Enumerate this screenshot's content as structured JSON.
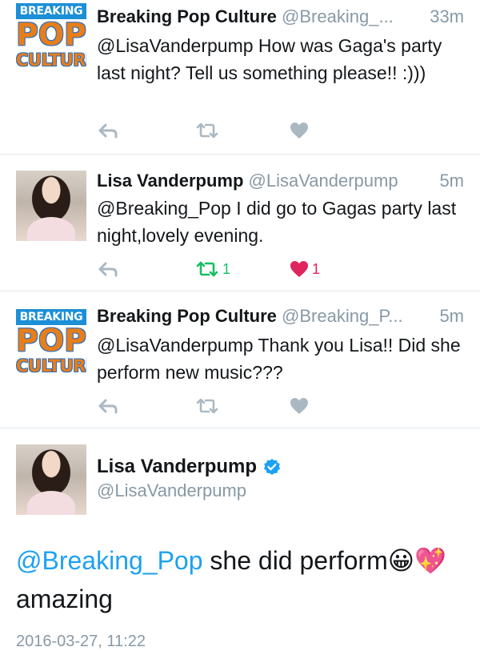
{
  "tweets": [
    {
      "name": "Breaking Pop Culture",
      "handle": "@Breaking_...",
      "time": "33m",
      "text": "@LisaVanderpump How was Gaga's party last night? Tell us something please!! :)))",
      "logo": {
        "line1": "BREAKING",
        "line2": "POP",
        "line3": "CULTURE"
      },
      "retweet_count": "",
      "like_count": ""
    },
    {
      "name": "Lisa Vanderpump",
      "handle": "@LisaVanderpump",
      "time": "5m",
      "text": "@Breaking_Pop I did go to Gagas party last night,lovely evening.",
      "retweet_count": "1",
      "like_count": "1"
    },
    {
      "name": "Breaking Pop Culture",
      "handle": "@Breaking_P...",
      "time": "5m",
      "text": "@LisaVanderpump Thank you Lisa!! Did she perform new music???",
      "logo": {
        "line1": "BREAKING",
        "line2": "POP",
        "line3": "CULTURE"
      },
      "retweet_count": "",
      "like_count": ""
    }
  ],
  "main_tweet": {
    "name": "Lisa Vanderpump",
    "handle": "@LisaVanderpump",
    "mention": "@Breaking_Pop",
    "text_after_mention": " she did perform",
    "emoji": "😀💖",
    "line2": "amazing",
    "date": "2016-03-27, 11:22"
  },
  "colors": {
    "link": "#1da1f2",
    "muted": "#8899a6",
    "retweet_active": "#17bf63",
    "like_active": "#e0245e",
    "verified": "#1da1f2"
  },
  "icons": {
    "reply": "reply-icon",
    "retweet": "retweet-icon",
    "like": "heart-icon",
    "verified": "verified-badge-icon"
  }
}
